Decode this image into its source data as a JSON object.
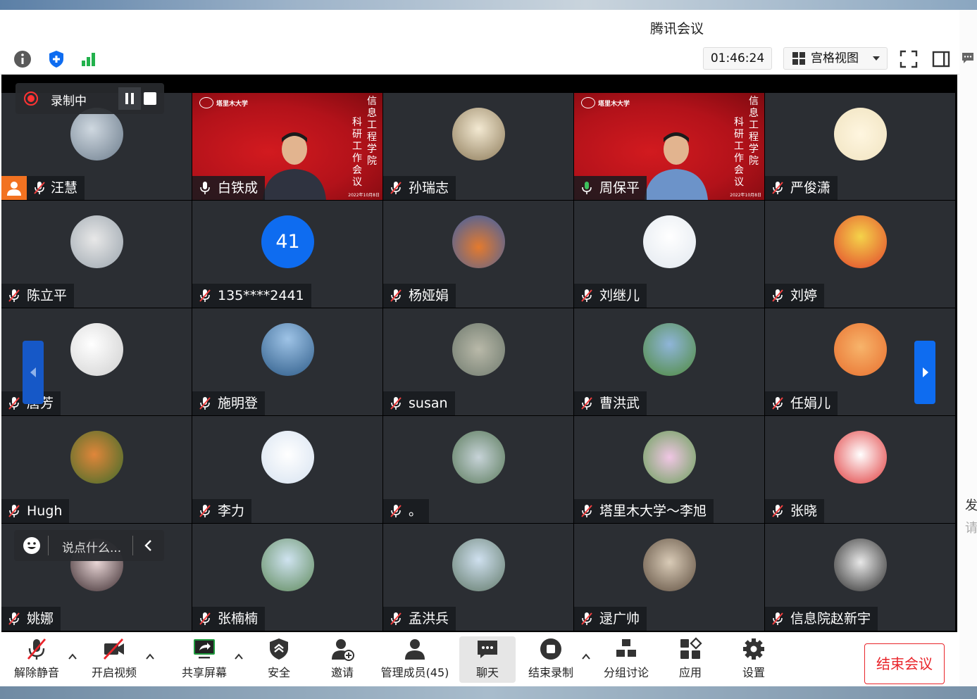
{
  "window": {
    "title": "腾讯会议"
  },
  "topbar": {
    "info_icon": "info-icon",
    "security_icon": "shield-icon",
    "signal_icon": "signal-icon",
    "timer": "01:46:24",
    "view_label": "宫格视图",
    "fullscreen_icon": "fullscreen-icon",
    "sidebar_icon": "sidebar-toggle-icon"
  },
  "recording": {
    "label": "录制中"
  },
  "chat_input": {
    "placeholder": "说点什么..."
  },
  "tiles": [
    {
      "name": "汪慧",
      "mic": "muted",
      "host": true
    },
    {
      "name": "白铁成",
      "mic": "on",
      "slide": true
    },
    {
      "name": "孙瑞志",
      "mic": "muted"
    },
    {
      "name": "周保平",
      "mic": "speaking",
      "slide": true,
      "active": true
    },
    {
      "name": "严俊潇",
      "mic": "muted"
    },
    {
      "name": "陈立平",
      "mic": "muted"
    },
    {
      "name": "135****2441",
      "mic": "muted",
      "avatar_text": "41"
    },
    {
      "name": "杨娅娟",
      "mic": "muted"
    },
    {
      "name": "刘继儿",
      "mic": "muted"
    },
    {
      "name": "刘婷",
      "mic": "muted"
    },
    {
      "name": "唐芳",
      "mic": "muted"
    },
    {
      "name": "施明登",
      "mic": "muted"
    },
    {
      "name": "susan",
      "mic": "muted"
    },
    {
      "name": "曹洪武",
      "mic": "muted"
    },
    {
      "name": "任娟儿",
      "mic": "muted"
    },
    {
      "name": "Hugh",
      "mic": "muted"
    },
    {
      "name": "李力",
      "mic": "muted"
    },
    {
      "name": "。",
      "mic": "muted"
    },
    {
      "name": "塔里木大学～李旭",
      "mic": "muted"
    },
    {
      "name": "张晓",
      "mic": "muted"
    },
    {
      "name": "姚娜",
      "mic": "muted"
    },
    {
      "name": "张楠楠",
      "mic": "muted"
    },
    {
      "name": "孟洪兵",
      "mic": "muted"
    },
    {
      "name": "逯广帅",
      "mic": "muted"
    },
    {
      "name": "信息院赵新宇",
      "mic": "muted"
    }
  ],
  "slide": {
    "university": "塔里木大学",
    "vertical_line1": "信息工程学院",
    "vertical_line2": "科研工作会议",
    "date": "2022年10月8日"
  },
  "toolbar": {
    "items": [
      {
        "label": "解除静音",
        "icon": "mic-muted-icon"
      },
      {
        "label": "开启视频",
        "icon": "video-off-icon"
      },
      {
        "label": "共享屏幕",
        "icon": "share-screen-icon"
      },
      {
        "label": "安全",
        "icon": "security-icon"
      },
      {
        "label": "邀请",
        "icon": "invite-icon"
      },
      {
        "label": "管理成员(45)",
        "icon": "members-icon"
      },
      {
        "label": "聊天",
        "icon": "chat-icon"
      },
      {
        "label": "结束录制",
        "icon": "stop-record-icon"
      },
      {
        "label": "分组讨论",
        "icon": "breakout-icon"
      },
      {
        "label": "应用",
        "icon": "apps-icon"
      },
      {
        "label": "设置",
        "icon": "settings-icon"
      }
    ],
    "end_label": "结束会议"
  },
  "side_peek": {
    "line1": "发",
    "line2": "请"
  },
  "colors": {
    "accent": "#0e6cf0",
    "danger": "#e9242a",
    "tile_bg": "#2b2e33",
    "speaking": "#3ec15d",
    "host": "#f27221"
  }
}
